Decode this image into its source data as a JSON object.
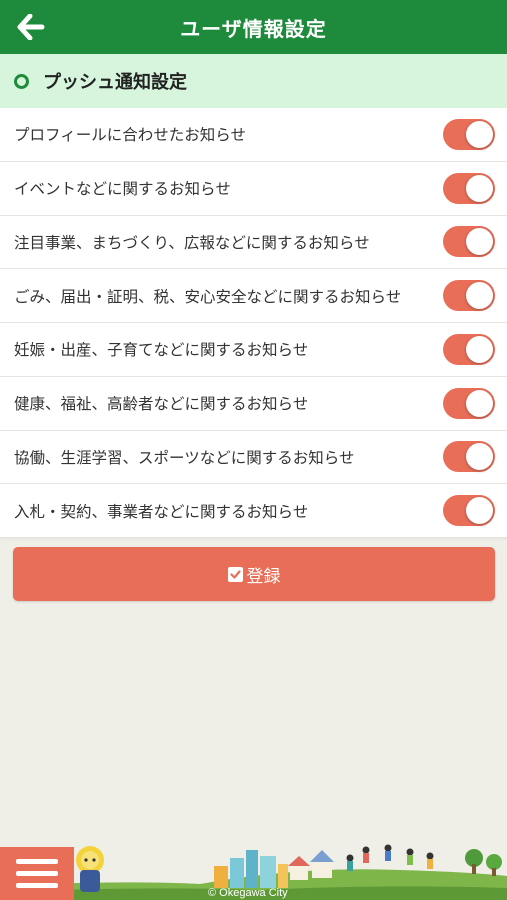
{
  "header": {
    "title": "ユーザ情報設定",
    "back_icon": "arrow-left-icon"
  },
  "section": {
    "title": "プッシュ通知設定"
  },
  "settings": [
    {
      "label": "プロフィールに合わせたお知らせ",
      "enabled": true
    },
    {
      "label": "イベントなどに関するお知らせ",
      "enabled": true
    },
    {
      "label": "注目事業、まちづくり、広報などに関するお知らせ",
      "enabled": true
    },
    {
      "label": "ごみ、届出・証明、税、安心安全などに関するお知らせ",
      "enabled": true
    },
    {
      "label": "妊娠・出産、子育てなどに関するお知らせ",
      "enabled": true
    },
    {
      "label": "健康、福祉、高齢者などに関するお知らせ",
      "enabled": true
    },
    {
      "label": "協働、生涯学習、スポーツなどに関するお知らせ",
      "enabled": true
    },
    {
      "label": "入札・契約、事業者などに関するお知らせ",
      "enabled": true
    }
  ],
  "submit": {
    "label": "登録",
    "icon": "checkbox-icon"
  },
  "footer": {
    "copyright": "© Okegawa City",
    "menu_icon": "hamburger-menu-icon"
  },
  "colors": {
    "header_green": "#1e8a3c",
    "section_bg": "#d6f5dc",
    "accent": "#e96e58",
    "page_bg": "#efeee7"
  }
}
